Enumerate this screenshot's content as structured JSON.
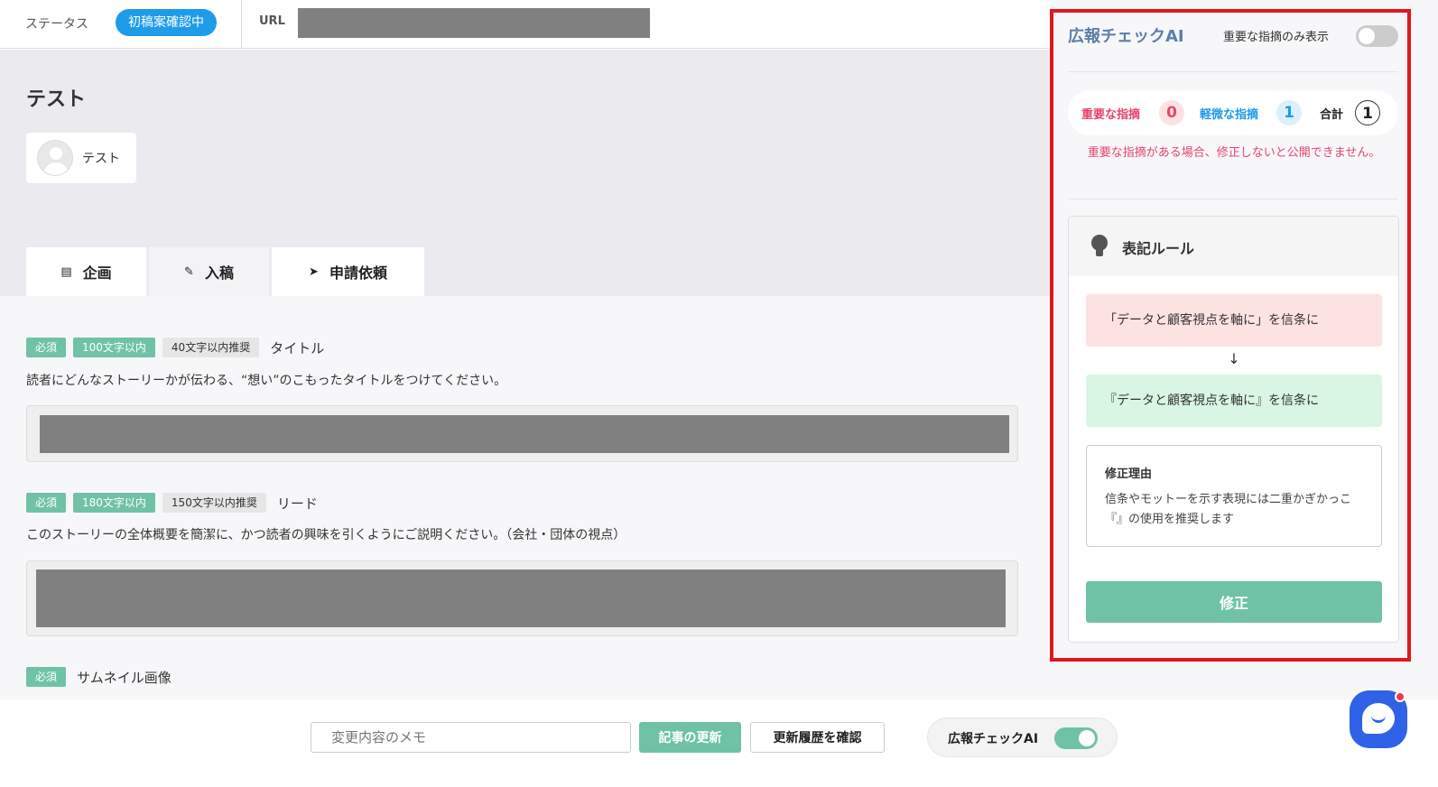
{
  "header": {
    "status_label": "ステータス",
    "status_badge": "初稿案確認中",
    "url_label": "URL"
  },
  "article": {
    "title": "テスト",
    "author": "テスト"
  },
  "tabs": [
    {
      "icon": "calendar-icon",
      "label": "企画"
    },
    {
      "icon": "pencil-icon",
      "label": "入稿"
    },
    {
      "icon": "send-icon",
      "label": "申請依頼"
    }
  ],
  "fields": [
    {
      "required": "必須",
      "limit": "100文字以内",
      "recommend": "40文字以内推奨",
      "label": "タイトル",
      "description": "読者にどんなストーリーかが伝わる、“想い”のこもったタイトルをつけてください。"
    },
    {
      "required": "必須",
      "limit": "180文字以内",
      "recommend": "150文字以内推奨",
      "label": "リード",
      "description": "このストーリーの全体概要を簡潔に、かつ読者の興味を引くようにご説明ください。（会社・団体の視点）"
    },
    {
      "required": "必須",
      "label": "サムネイル画像"
    }
  ],
  "bottom_bar": {
    "memo_placeholder": "変更内容のメモ",
    "update_button": "記事の更新",
    "history_button": "更新履歴を確認",
    "ai_toggle_label": "広報チェックAI",
    "ai_toggle_on": true
  },
  "ai_panel": {
    "title": "広報チェックAI",
    "important_only_label": "重要な指摘のみ表示",
    "important_only_on": false,
    "counts": {
      "important_label": "重要な指摘",
      "important_value": "0",
      "minor_label": "軽微な指摘",
      "minor_value": "1",
      "total_label": "合計",
      "total_value": "1"
    },
    "warning": "重要な指摘がある場合、修正しないと公開できません。",
    "rule": {
      "title": "表記ルール",
      "before": "「データと顧客視点を軸に」を信条に",
      "arrow": "↓",
      "after": "『データと顧客視点を軸に』を信条に",
      "reason_title": "修正理由",
      "reason_text": "信条やモットーを示す表現には二重かぎかっこ『』の使用を推奨します",
      "fix_button": "修正"
    }
  },
  "colors": {
    "accent_green": "#6fc2a6",
    "status_blue": "#1e9be9",
    "important_red": "#e6446b",
    "minor_blue": "#1e9be9",
    "highlight_border": "#e0161f"
  }
}
